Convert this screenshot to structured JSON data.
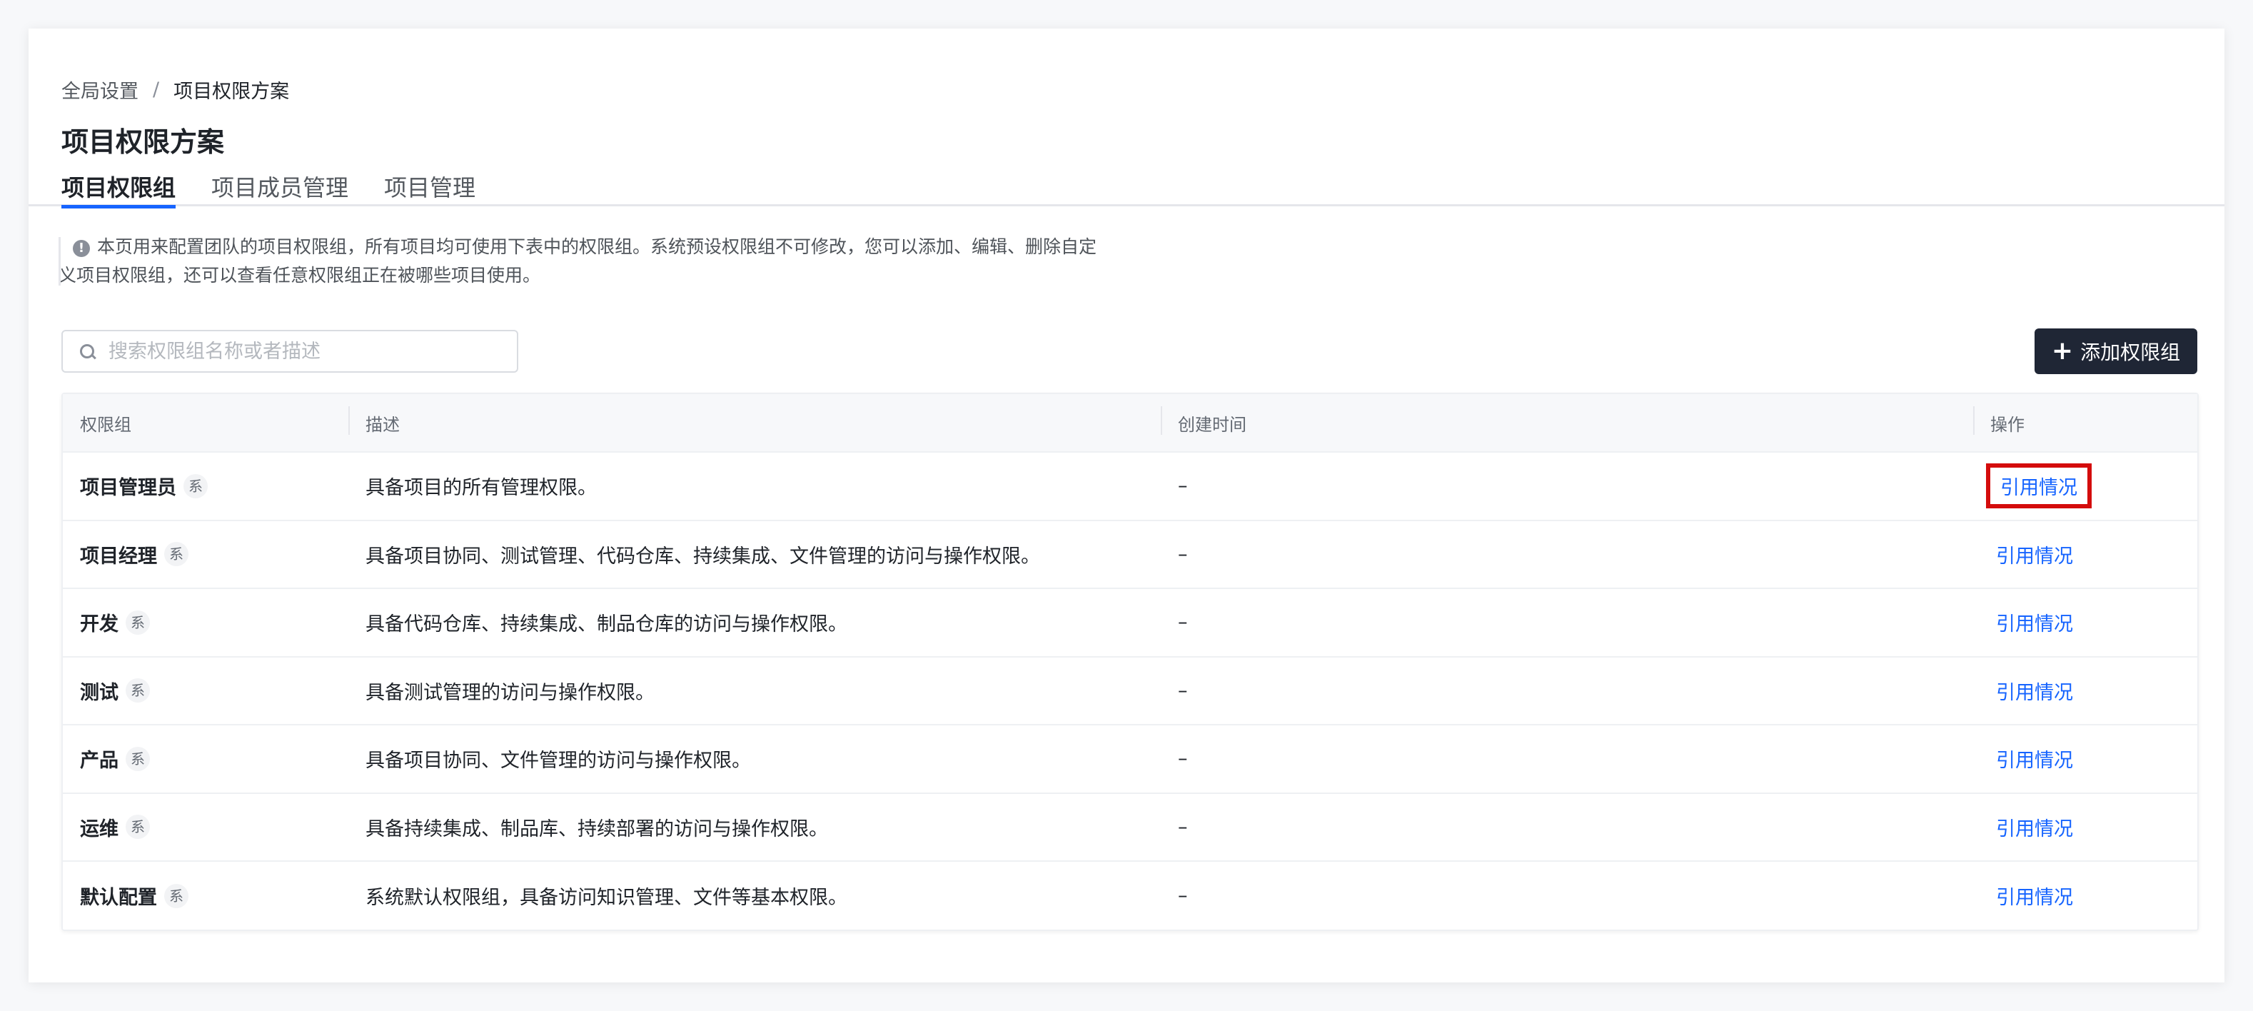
{
  "breadcrumb": {
    "root": "全局设置",
    "separator": "/",
    "current": "项目权限方案"
  },
  "page_title": "项目权限方案",
  "tabs": [
    {
      "label": "项目权限组",
      "active": true
    },
    {
      "label": "项目成员管理",
      "active": false
    },
    {
      "label": "项目管理",
      "active": false
    }
  ],
  "notice": {
    "icon": "info-icon",
    "line1": "本页用来配置团队的项目权限组，所有项目均可使用下表中的权限组。系统预设权限组不可修改，您可以添加、编辑、删除自定",
    "line2": "义项目权限组，还可以查看任意权限组正在被哪些项目使用。"
  },
  "search": {
    "placeholder": "搜索权限组名称或者描述",
    "value": ""
  },
  "add_button": {
    "label": "添加权限组",
    "icon": "plus-icon"
  },
  "table": {
    "headers": [
      "权限组",
      "描述",
      "创建时间",
      "操作"
    ],
    "rows": [
      {
        "name": "项目管理员",
        "badge": "系",
        "description": "具备项目的所有管理权限。",
        "created": "–",
        "action": "引用情况"
      },
      {
        "name": "项目经理",
        "badge": "系",
        "description": "具备项目协同、测试管理、代码仓库、持续集成、文件管理的访问与操作权限。",
        "created": "–",
        "action": "引用情况"
      },
      {
        "name": "开发",
        "badge": "系",
        "description": "具备代码仓库、持续集成、制品仓库的访问与操作权限。",
        "created": "–",
        "action": "引用情况"
      },
      {
        "name": "测试",
        "badge": "系",
        "description": "具备测试管理的访问与操作权限。",
        "created": "–",
        "action": "引用情况"
      },
      {
        "name": "产品",
        "badge": "系",
        "description": "具备项目协同、文件管理的访问与操作权限。",
        "created": "–",
        "action": "引用情况"
      },
      {
        "name": "运维",
        "badge": "系",
        "description": "具备持续集成、制品库、持续部署的访问与操作权限。",
        "created": "–",
        "action": "引用情况"
      },
      {
        "name": "默认配置",
        "badge": "系",
        "description": "系统默认权限组，具备访问知识管理、文件等基本权限。",
        "created": "–",
        "action": "引用情况"
      }
    ]
  },
  "colors": {
    "accent": "#1664ff",
    "primary_button": "#1f2635",
    "highlight_box": "#d40c0c"
  }
}
